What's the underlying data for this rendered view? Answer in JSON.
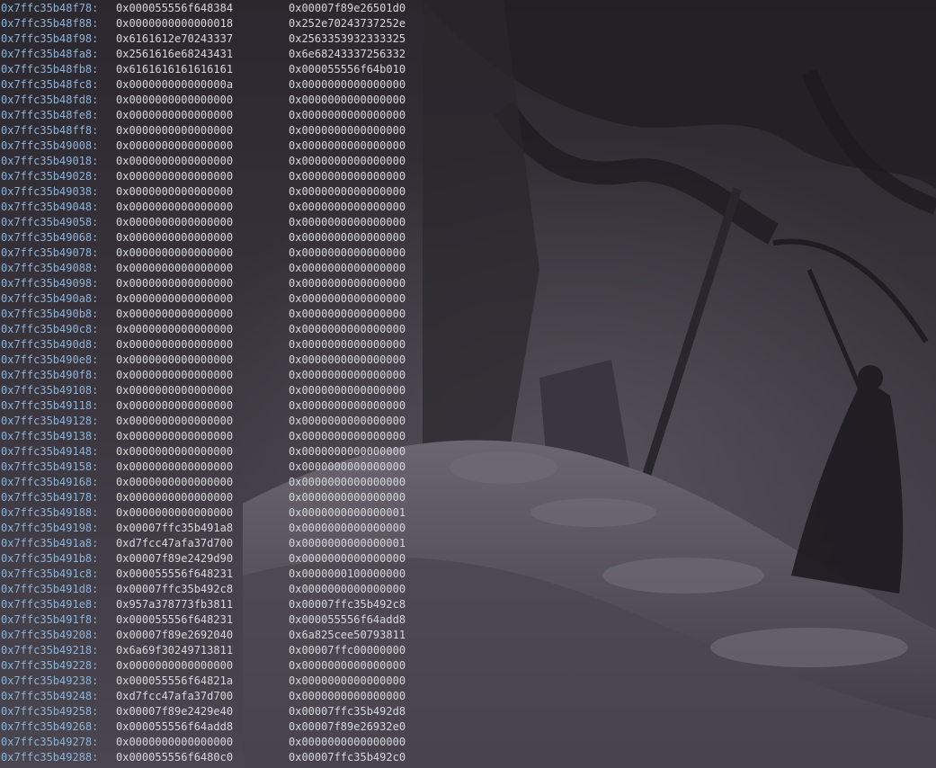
{
  "terminal": {
    "rows": [
      {
        "addr": "0x7ffc35b48f78",
        "v1": "0x000055556f648384",
        "v2": "0x00007f89e26501d0"
      },
      {
        "addr": "0x7ffc35b48f88",
        "v1": "0x0000000000000018",
        "v2": "0x252e70243737252e"
      },
      {
        "addr": "0x7ffc35b48f98",
        "v1": "0x6161612e70243337",
        "v2": "0x2563353932333325"
      },
      {
        "addr": "0x7ffc35b48fa8",
        "v1": "0x2561616e68243431",
        "v2": "0x6e68243337256332"
      },
      {
        "addr": "0x7ffc35b48fb8",
        "v1": "0x6161616161616161",
        "v2": "0x000055556f64b010"
      },
      {
        "addr": "0x7ffc35b48fc8",
        "v1": "0x000000000000000a",
        "v2": "0x0000000000000000"
      },
      {
        "addr": "0x7ffc35b48fd8",
        "v1": "0x0000000000000000",
        "v2": "0x0000000000000000"
      },
      {
        "addr": "0x7ffc35b48fe8",
        "v1": "0x0000000000000000",
        "v2": "0x0000000000000000"
      },
      {
        "addr": "0x7ffc35b48ff8",
        "v1": "0x0000000000000000",
        "v2": "0x0000000000000000"
      },
      {
        "addr": "0x7ffc35b49008",
        "v1": "0x0000000000000000",
        "v2": "0x0000000000000000"
      },
      {
        "addr": "0x7ffc35b49018",
        "v1": "0x0000000000000000",
        "v2": "0x0000000000000000"
      },
      {
        "addr": "0x7ffc35b49028",
        "v1": "0x0000000000000000",
        "v2": "0x0000000000000000"
      },
      {
        "addr": "0x7ffc35b49038",
        "v1": "0x0000000000000000",
        "v2": "0x0000000000000000"
      },
      {
        "addr": "0x7ffc35b49048",
        "v1": "0x0000000000000000",
        "v2": "0x0000000000000000"
      },
      {
        "addr": "0x7ffc35b49058",
        "v1": "0x0000000000000000",
        "v2": "0x0000000000000000"
      },
      {
        "addr": "0x7ffc35b49068",
        "v1": "0x0000000000000000",
        "v2": "0x0000000000000000"
      },
      {
        "addr": "0x7ffc35b49078",
        "v1": "0x0000000000000000",
        "v2": "0x0000000000000000"
      },
      {
        "addr": "0x7ffc35b49088",
        "v1": "0x0000000000000000",
        "v2": "0x0000000000000000"
      },
      {
        "addr": "0x7ffc35b49098",
        "v1": "0x0000000000000000",
        "v2": "0x0000000000000000"
      },
      {
        "addr": "0x7ffc35b490a8",
        "v1": "0x0000000000000000",
        "v2": "0x0000000000000000"
      },
      {
        "addr": "0x7ffc35b490b8",
        "v1": "0x0000000000000000",
        "v2": "0x0000000000000000"
      },
      {
        "addr": "0x7ffc35b490c8",
        "v1": "0x0000000000000000",
        "v2": "0x0000000000000000"
      },
      {
        "addr": "0x7ffc35b490d8",
        "v1": "0x0000000000000000",
        "v2": "0x0000000000000000"
      },
      {
        "addr": "0x7ffc35b490e8",
        "v1": "0x0000000000000000",
        "v2": "0x0000000000000000"
      },
      {
        "addr": "0x7ffc35b490f8",
        "v1": "0x0000000000000000",
        "v2": "0x0000000000000000"
      },
      {
        "addr": "0x7ffc35b49108",
        "v1": "0x0000000000000000",
        "v2": "0x0000000000000000"
      },
      {
        "addr": "0x7ffc35b49118",
        "v1": "0x0000000000000000",
        "v2": "0x0000000000000000"
      },
      {
        "addr": "0x7ffc35b49128",
        "v1": "0x0000000000000000",
        "v2": "0x0000000000000000"
      },
      {
        "addr": "0x7ffc35b49138",
        "v1": "0x0000000000000000",
        "v2": "0x0000000000000000"
      },
      {
        "addr": "0x7ffc35b49148",
        "v1": "0x0000000000000000",
        "v2": "0x0000000000000000"
      },
      {
        "addr": "0x7ffc35b49158",
        "v1": "0x0000000000000000",
        "v2": "0x0000000000000000"
      },
      {
        "addr": "0x7ffc35b49168",
        "v1": "0x0000000000000000",
        "v2": "0x0000000000000000"
      },
      {
        "addr": "0x7ffc35b49178",
        "v1": "0x0000000000000000",
        "v2": "0x0000000000000000"
      },
      {
        "addr": "0x7ffc35b49188",
        "v1": "0x0000000000000000",
        "v2": "0x0000000000000001"
      },
      {
        "addr": "0x7ffc35b49198",
        "v1": "0x00007ffc35b491a8",
        "v2": "0x0000000000000000"
      },
      {
        "addr": "0x7ffc35b491a8",
        "v1": "0xd7fcc47afa37d700",
        "v2": "0x0000000000000001"
      },
      {
        "addr": "0x7ffc35b491b8",
        "v1": "0x00007f89e2429d90",
        "v2": "0x0000000000000000"
      },
      {
        "addr": "0x7ffc35b491c8",
        "v1": "0x000055556f648231",
        "v2": "0x0000000100000000"
      },
      {
        "addr": "0x7ffc35b491d8",
        "v1": "0x00007ffc35b492c8",
        "v2": "0x0000000000000000"
      },
      {
        "addr": "0x7ffc35b491e8",
        "v1": "0x957a378773fb3811",
        "v2": "0x00007ffc35b492c8"
      },
      {
        "addr": "0x7ffc35b491f8",
        "v1": "0x000055556f648231",
        "v2": "0x000055556f64add8"
      },
      {
        "addr": "0x7ffc35b49208",
        "v1": "0x00007f89e2692040",
        "v2": "0x6a825cee50793811"
      },
      {
        "addr": "0x7ffc35b49218",
        "v1": "0x6a69f30249713811",
        "v2": "0x00007ffc00000000"
      },
      {
        "addr": "0x7ffc35b49228",
        "v1": "0x0000000000000000",
        "v2": "0x0000000000000000"
      },
      {
        "addr": "0x7ffc35b49238",
        "v1": "0x000055556f64821a",
        "v2": "0x0000000000000000"
      },
      {
        "addr": "0x7ffc35b49248",
        "v1": "0xd7fcc47afa37d700",
        "v2": "0x0000000000000000"
      },
      {
        "addr": "0x7ffc35b49258",
        "v1": "0x00007f89e2429e40",
        "v2": "0x00007ffc35b492d8"
      },
      {
        "addr": "0x7ffc35b49268",
        "v1": "0x000055556f64add8",
        "v2": "0x00007f89e26932e0"
      },
      {
        "addr": "0x7ffc35b49278",
        "v1": "0x0000000000000000",
        "v2": "0x0000000000000000"
      },
      {
        "addr": "0x7ffc35b49288",
        "v1": "0x000055556f6480c0",
        "v2": "0x00007ffc35b492c0"
      }
    ]
  },
  "colors": {
    "background": "#35313a",
    "address_text": "#8fb3d6",
    "value_text": "#d8d8dc"
  }
}
